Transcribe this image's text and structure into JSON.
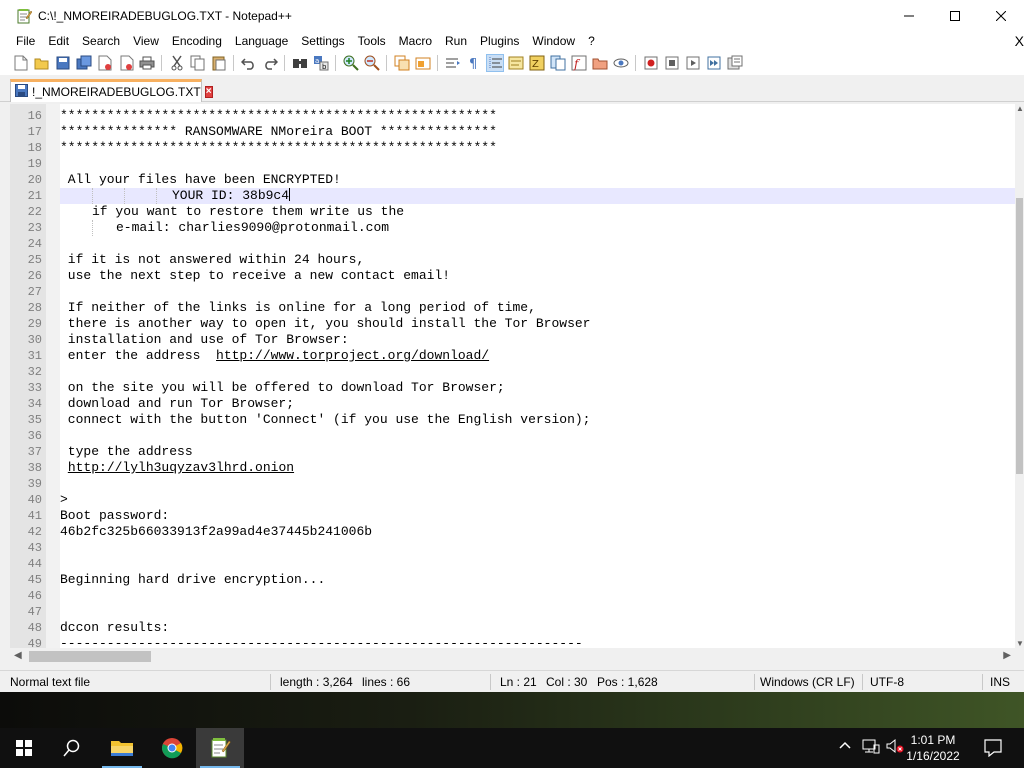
{
  "window": {
    "title": "C:\\!_NMOREIRADEBUGLOG.TXT - Notepad++"
  },
  "menu": {
    "items": [
      "File",
      "Edit",
      "Search",
      "View",
      "Encoding",
      "Language",
      "Settings",
      "Tools",
      "Macro",
      "Run",
      "Plugins",
      "Window",
      "?"
    ],
    "close_glyph": "X"
  },
  "toolbar": {
    "icons": [
      "new-file-icon",
      "open-file-icon",
      "save-icon",
      "save-all-icon",
      "close-icon",
      "close-all-icon",
      "print-icon",
      "cut-icon",
      "copy-icon",
      "paste-icon",
      "undo-icon",
      "redo-icon",
      "find-icon",
      "replace-icon",
      "zoom-in-icon",
      "zoom-out-icon",
      "sync-vertical-icon",
      "sync-horizontal-icon",
      "word-wrap-icon",
      "show-all-chars-icon",
      "indent-guide-icon",
      "user-defined-language-icon",
      "doc-map-icon",
      "document-list-icon",
      "function-list-icon",
      "folder-workspace-icon",
      "monitoring-icon",
      "record-macro-icon",
      "stop-macro-icon",
      "play-macro-icon",
      "run-macro-multiple-icon",
      "save-macro-icon"
    ]
  },
  "tabs": [
    {
      "label": "!_NMOREIRADEBUGLOG.TXT",
      "active": true
    }
  ],
  "editor": {
    "current_line": 21,
    "lines": [
      {
        "n": "16",
        "text": "********************************************************"
      },
      {
        "n": "17",
        "text": "*************** RANSOMWARE NMoreira BOOT ***************"
      },
      {
        "n": "18",
        "text": "********************************************************"
      },
      {
        "n": "19",
        "text": ""
      },
      {
        "n": "20",
        "text": " All your files have been ENCRYPTED!"
      },
      {
        "n": "21",
        "text": "YOUR ID: 38b9c4"
      },
      {
        "n": "22",
        "text": "if you want to restore them write us the"
      },
      {
        "n": "23",
        "text": "e-mail: charlies9090@protonmail.com"
      },
      {
        "n": "24",
        "text": ""
      },
      {
        "n": "25",
        "text": " if it is not answered within 24 hours,"
      },
      {
        "n": "26",
        "text": " use the next step to receive a new contact email!"
      },
      {
        "n": "27",
        "text": ""
      },
      {
        "n": "28",
        "text": " If neither of the links is online for a long period of time,"
      },
      {
        "n": "29",
        "text": " there is another way to open it, you should install the Tor Browser"
      },
      {
        "n": "30",
        "text": " installation and use of Tor Browser:"
      },
      {
        "n": "31",
        "text": " enter the address  "
      },
      {
        "n": "32",
        "text": ""
      },
      {
        "n": "33",
        "text": " on the site you will be offered to download Tor Browser;"
      },
      {
        "n": "34",
        "text": " download and run Tor Browser;"
      },
      {
        "n": "35",
        "text": " connect with the button 'Connect' (if you use the English version);"
      },
      {
        "n": "36",
        "text": ""
      },
      {
        "n": "37",
        "text": " type the address"
      },
      {
        "n": "38",
        "text": " "
      },
      {
        "n": "39",
        "text": ""
      },
      {
        "n": "40",
        "text": ">"
      },
      {
        "n": "41",
        "text": "Boot password:"
      },
      {
        "n": "42",
        "text": "46b2fc325b66033913f2a99ad4e37445b241006b"
      },
      {
        "n": "43",
        "text": ""
      },
      {
        "n": "44",
        "text": ""
      },
      {
        "n": "45",
        "text": "Beginning hard drive encryption..."
      },
      {
        "n": "46",
        "text": ""
      },
      {
        "n": "47",
        "text": ""
      },
      {
        "n": "48",
        "text": "dccon results:"
      },
      {
        "n": "49",
        "text": "-------------------------------------------------------------------"
      }
    ],
    "link_lines": {
      "31": "http://www.torproject.org/download/",
      "38": "http://lylh3uqyzav3lhrd.onion"
    }
  },
  "status": {
    "file_type": "Normal text file",
    "length": "length : 3,264",
    "lines": "lines : 66",
    "ln": "Ln : 21",
    "col": "Col : 30",
    "pos": "Pos : 1,628",
    "eol": "Windows (CR LF)",
    "encoding": "UTF-8",
    "mode": "INS"
  },
  "taskbar": {
    "time": "1:01 PM",
    "date": "1/16/2022",
    "pinned": [
      "start-icon",
      "search-icon",
      "file-explorer-icon",
      "chrome-icon",
      "notepad-plus-plus-icon"
    ]
  },
  "colors": {
    "tab_accent": "#f7b060",
    "current_line": "#e8e8ff",
    "taskbar": "#101010",
    "accent_blue": "#76b9ed"
  }
}
